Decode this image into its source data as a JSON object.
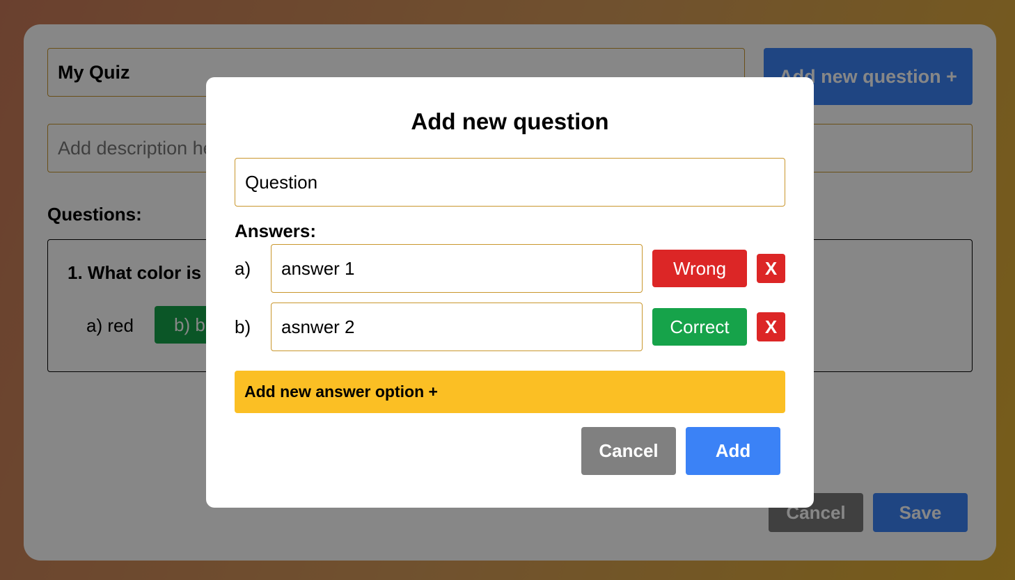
{
  "background": {
    "quiz_title_value": "My Quiz",
    "add_question_label": "Add new question +",
    "description_placeholder": "Add description here",
    "questions_heading": "Questions:",
    "questions": [
      {
        "text": "1. What color is",
        "answers": [
          {
            "label": "a) red",
            "correct": false
          },
          {
            "label": "b) b",
            "correct": true
          }
        ]
      }
    ],
    "cancel_label": "Cancel",
    "save_label": "Save"
  },
  "modal": {
    "title": "Add new question",
    "question_placeholder": "Question",
    "answers_heading": "Answers:",
    "answers": [
      {
        "letter": "a)",
        "value": "answer 1",
        "status": "Wrong",
        "delete": "X"
      },
      {
        "letter": "b)",
        "value": "asnwer 2",
        "status": "Correct",
        "delete": "X"
      }
    ],
    "add_answer_label": "Add new answer option +",
    "cancel_label": "Cancel",
    "add_label": "Add"
  },
  "colors": {
    "primary": "#3b82f6",
    "danger": "#dc2626",
    "success": "#16a34a",
    "warning": "#fbbf24",
    "neutral": "#808080",
    "input_border": "#c9962c"
  }
}
